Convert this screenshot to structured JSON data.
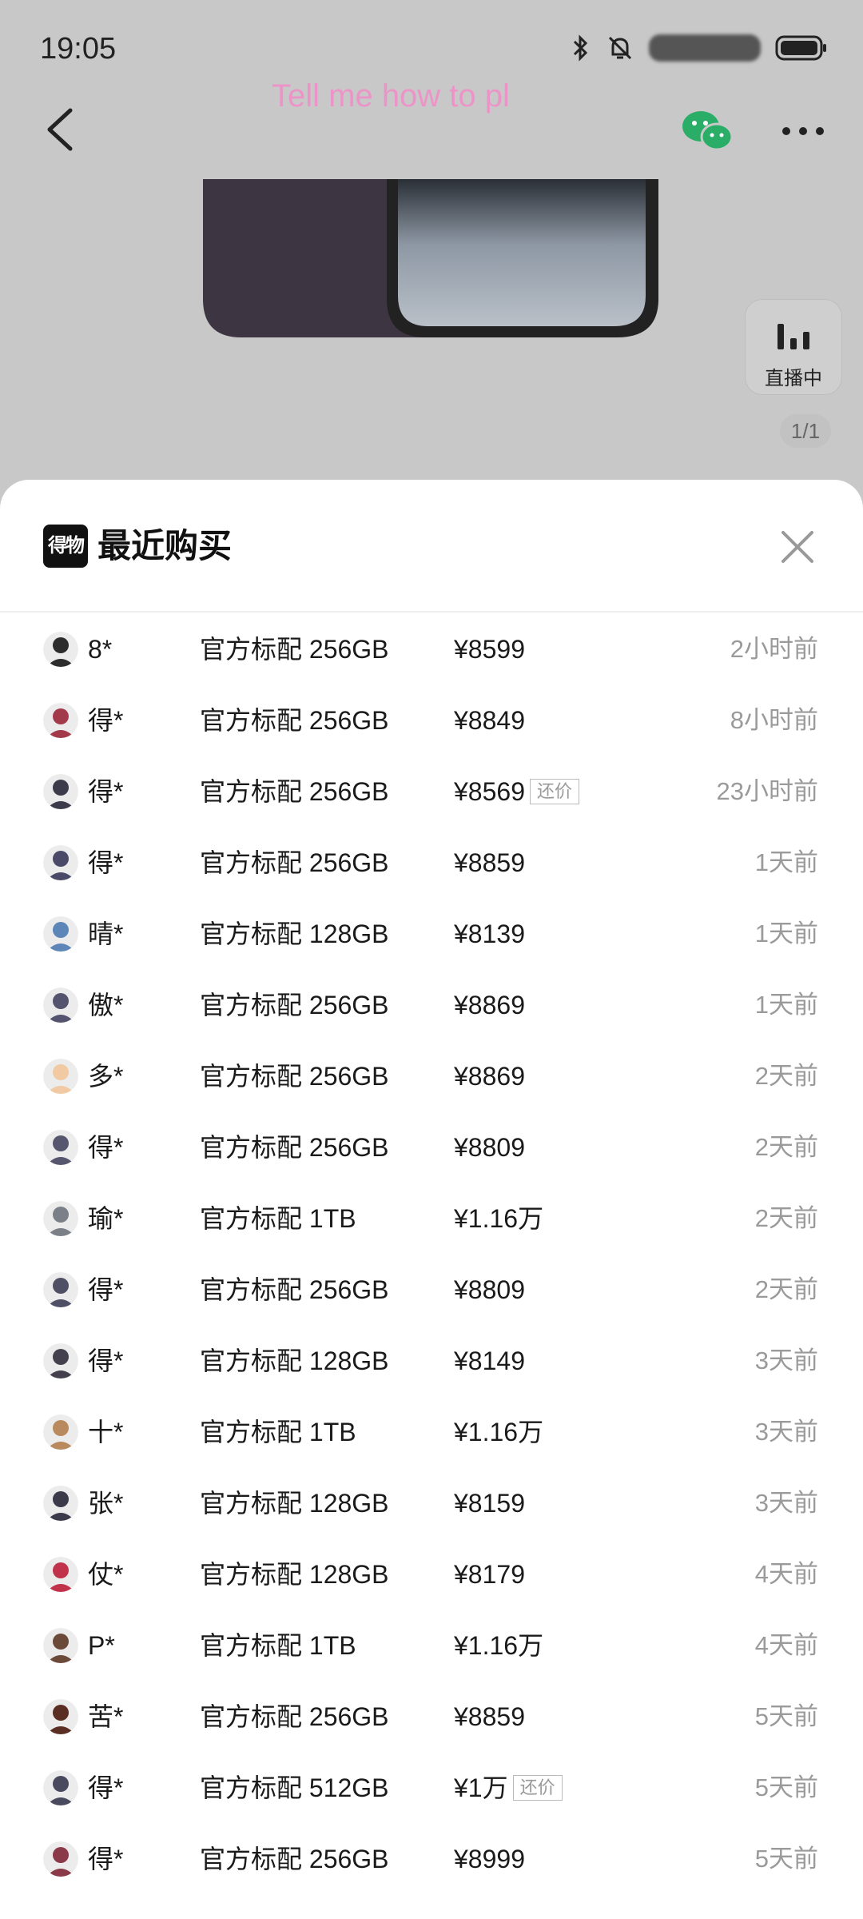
{
  "status_bar": {
    "time": "19:05"
  },
  "header": {
    "overlay_text": "Tell me how to pl"
  },
  "live_badge": {
    "label": "直播中"
  },
  "page_indicator": "1/1",
  "sheet": {
    "logo_text": "得物",
    "title": "最近购买"
  },
  "purchases": [
    {
      "name": "8*",
      "spec": "官方标配 256GB",
      "price": "¥8599",
      "bargain": "",
      "time": "2小时前",
      "avatar_color": "#2d2d2d"
    },
    {
      "name": "得*",
      "spec": "官方标配 256GB",
      "price": "¥8849",
      "bargain": "",
      "time": "8小时前",
      "avatar_color": "#a33a4a"
    },
    {
      "name": "得*",
      "spec": "官方标配 256GB",
      "price": "¥8569",
      "bargain": "还价",
      "time": "23小时前",
      "avatar_color": "#3b3b4b"
    },
    {
      "name": "得*",
      "spec": "官方标配 256GB",
      "price": "¥8859",
      "bargain": "",
      "time": "1天前",
      "avatar_color": "#4a4a68"
    },
    {
      "name": "晴*",
      "spec": "官方标配 128GB",
      "price": "¥8139",
      "bargain": "",
      "time": "1天前",
      "avatar_color": "#5d86b8"
    },
    {
      "name": "傲*",
      "spec": "官方标配 256GB",
      "price": "¥8869",
      "bargain": "",
      "time": "1天前",
      "avatar_color": "#54546e"
    },
    {
      "name": "多*",
      "spec": "官方标配 256GB",
      "price": "¥8869",
      "bargain": "",
      "time": "2天前",
      "avatar_color": "#f1c9a3"
    },
    {
      "name": "得*",
      "spec": "官方标配 256GB",
      "price": "¥8809",
      "bargain": "",
      "time": "2天前",
      "avatar_color": "#56566e"
    },
    {
      "name": "瑜*",
      "spec": "官方标配 1TB",
      "price": "¥1.16万",
      "bargain": "",
      "time": "2天前",
      "avatar_color": "#7b7f88"
    },
    {
      "name": "得*",
      "spec": "官方标配 256GB",
      "price": "¥8809",
      "bargain": "",
      "time": "2天前",
      "avatar_color": "#4f4f66"
    },
    {
      "name": "得*",
      "spec": "官方标配 128GB",
      "price": "¥8149",
      "bargain": "",
      "time": "3天前",
      "avatar_color": "#44404e"
    },
    {
      "name": "十*",
      "spec": "官方标配 1TB",
      "price": "¥1.16万",
      "bargain": "",
      "time": "3天前",
      "avatar_color": "#b88a5e"
    },
    {
      "name": "张*",
      "spec": "官方标配 128GB",
      "price": "¥8159",
      "bargain": "",
      "time": "3天前",
      "avatar_color": "#3a3a4a"
    },
    {
      "name": "仗*",
      "spec": "官方标配 128GB",
      "price": "¥8179",
      "bargain": "",
      "time": "4天前",
      "avatar_color": "#c0334a"
    },
    {
      "name": "P*",
      "spec": "官方标配 1TB",
      "price": "¥1.16万",
      "bargain": "",
      "time": "4天前",
      "avatar_color": "#6b4a3a"
    },
    {
      "name": "苦*",
      "spec": "官方标配 256GB",
      "price": "¥8859",
      "bargain": "",
      "time": "5天前",
      "avatar_color": "#5a2e22"
    },
    {
      "name": "得*",
      "spec": "官方标配 512GB",
      "price": "¥1万",
      "bargain": "还价",
      "time": "5天前",
      "avatar_color": "#4a4a5e"
    },
    {
      "name": "得*",
      "spec": "官方标配 256GB",
      "price": "¥8999",
      "bargain": "",
      "time": "5天前",
      "avatar_color": "#8a3a48"
    }
  ],
  "icons": {
    "back": "chevron-left-icon",
    "share": "wechat-icon",
    "more": "more-dots-icon",
    "live": "live-bars-icon",
    "close": "close-icon",
    "bluetooth": "bluetooth-icon",
    "mute": "bell-off-icon",
    "battery": "battery-icon"
  },
  "colors": {
    "overlay_text": "#f08fc8",
    "wechat": "#2aae67",
    "dim_bg": "#c8c8c8"
  }
}
